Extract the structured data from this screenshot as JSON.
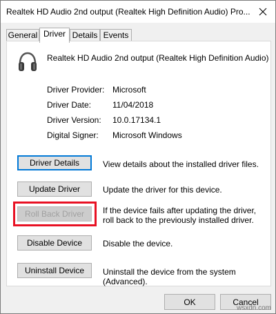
{
  "window": {
    "title": "Realtek HD Audio 2nd output (Realtek High Definition Audio) Pro..."
  },
  "tabs": [
    {
      "label": "General"
    },
    {
      "label": "Driver"
    },
    {
      "label": "Details"
    },
    {
      "label": "Events"
    }
  ],
  "device": {
    "icon": "headphones-icon",
    "name": "Realtek HD Audio 2nd output (Realtek High Definition Audio)"
  },
  "driver_info": [
    {
      "label": "Driver Provider:",
      "value": "Microsoft"
    },
    {
      "label": "Driver Date:",
      "value": "11/04/2018"
    },
    {
      "label": "Driver Version:",
      "value": "10.0.17134.1"
    },
    {
      "label": "Digital Signer:",
      "value": "Microsoft Windows"
    }
  ],
  "actions": [
    {
      "label": "Driver Details",
      "description": "View details about the installed driver files."
    },
    {
      "label": "Update Driver",
      "description": "Update the driver for this device."
    },
    {
      "label": "Roll Back Driver",
      "description": "If the device fails after updating the driver, roll back to the previously installed driver."
    },
    {
      "label": "Disable Device",
      "description": "Disable the device."
    },
    {
      "label": "Uninstall Device",
      "description": "Uninstall the device from the system (Advanced)."
    }
  ],
  "footer": {
    "ok_label": "OK",
    "cancel_label": "Cancel"
  },
  "watermark": "wsxdn.com",
  "colors": {
    "highlight": "#e81123",
    "focus": "#0078d7"
  }
}
